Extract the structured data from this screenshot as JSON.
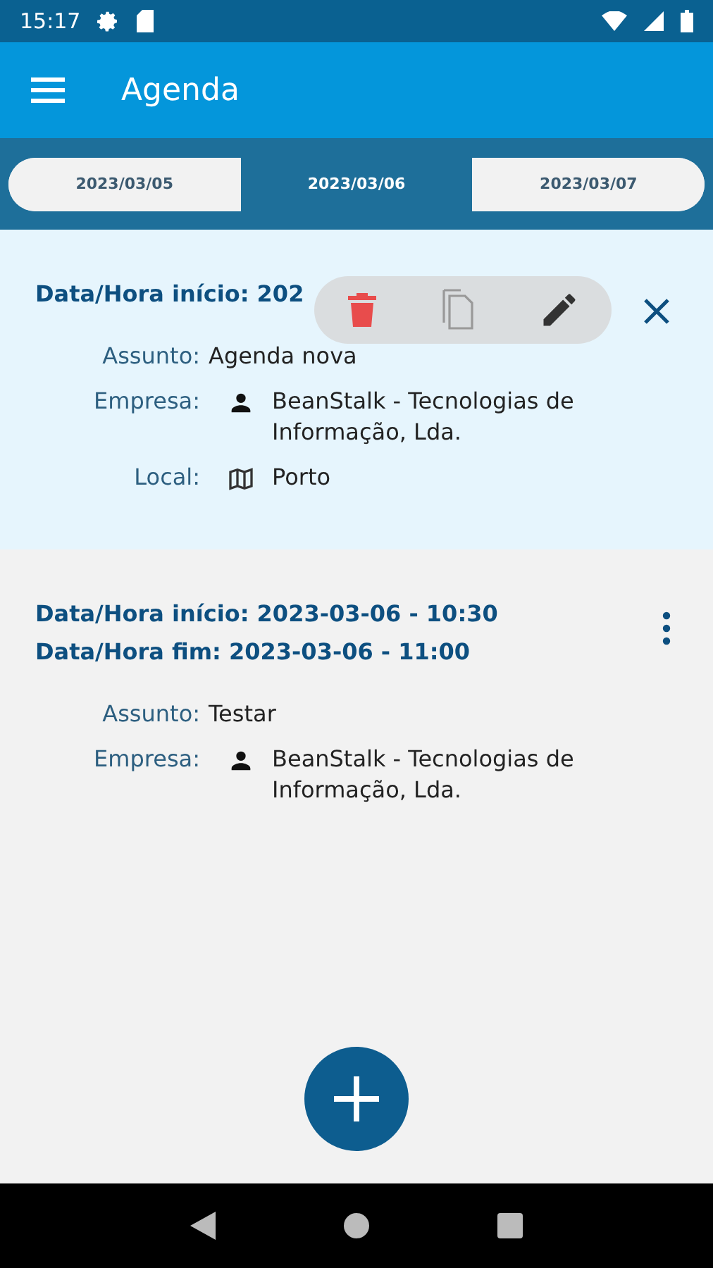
{
  "status_bar": {
    "time": "15:17"
  },
  "app_bar": {
    "title": "Agenda"
  },
  "date_tabs": [
    {
      "label": "2023/03/05",
      "selected": false
    },
    {
      "label": "2023/03/06",
      "selected": true
    },
    {
      "label": "2023/03/07",
      "selected": false
    }
  ],
  "events": [
    {
      "selected": true,
      "titles": [
        "Data/Hora início: 202"
      ],
      "actions": [
        {
          "kind": "delete"
        },
        {
          "kind": "copy"
        },
        {
          "kind": "edit"
        }
      ],
      "fields": [
        {
          "kind": "subject",
          "label": "Assunto:",
          "value": "Agenda nova"
        },
        {
          "kind": "company",
          "label": "Empresa:",
          "value": "BeanStalk - Tecnologias de Informação, Lda."
        },
        {
          "kind": "place",
          "label": "Local:",
          "value": "Porto"
        }
      ]
    },
    {
      "selected": false,
      "titles": [
        "Data/Hora início: 2023-03-06 - 10:30",
        "Data/Hora fim: 2023-03-06 - 11:00"
      ],
      "fields": [
        {
          "kind": "subject",
          "label": "Assunto:",
          "value": "Testar"
        },
        {
          "kind": "company",
          "label": "Empresa:",
          "value": "BeanStalk - Tecnologias de Informação, Lda."
        }
      ]
    }
  ]
}
